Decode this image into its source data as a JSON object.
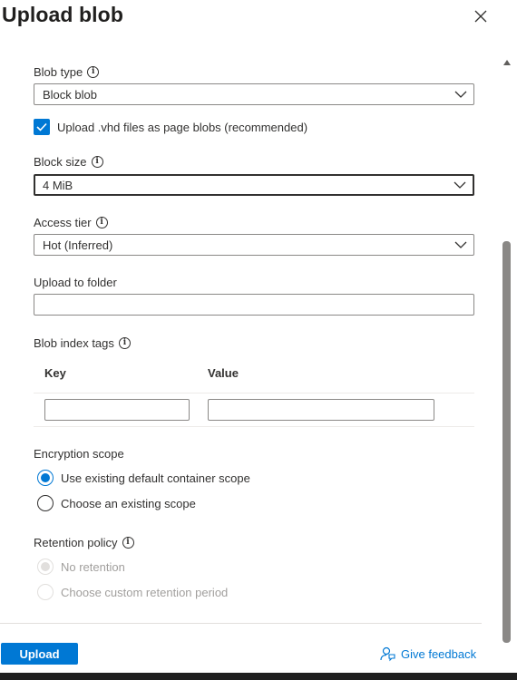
{
  "panel": {
    "title": "Upload blob",
    "close_icon": "close-icon"
  },
  "blob_type": {
    "label": "Blob type",
    "value": "Block blob"
  },
  "vhd_checkbox": {
    "label": "Upload .vhd files as page blobs (recommended)",
    "checked": true
  },
  "block_size": {
    "label": "Block size",
    "value": "4 MiB"
  },
  "access_tier": {
    "label": "Access tier",
    "value": "Hot (Inferred)"
  },
  "upload_folder": {
    "label": "Upload to folder",
    "value": ""
  },
  "index_tags": {
    "label": "Blob index tags",
    "columns": [
      "Key",
      "Value"
    ],
    "key_value": "",
    "value_value": ""
  },
  "encryption": {
    "label": "Encryption scope",
    "options": [
      "Use existing default container scope",
      "Choose an existing scope"
    ],
    "selected": 0
  },
  "retention": {
    "label": "Retention policy",
    "options": [
      "No retention",
      "Choose custom retention period"
    ],
    "selected": 0,
    "disabled": true
  },
  "footer": {
    "upload_label": "Upload",
    "feedback_label": "Give feedback"
  },
  "colors": {
    "accent": "#0078d4",
    "text": "#323130",
    "border": "#8a8886",
    "disabled": "#a19f9d"
  }
}
